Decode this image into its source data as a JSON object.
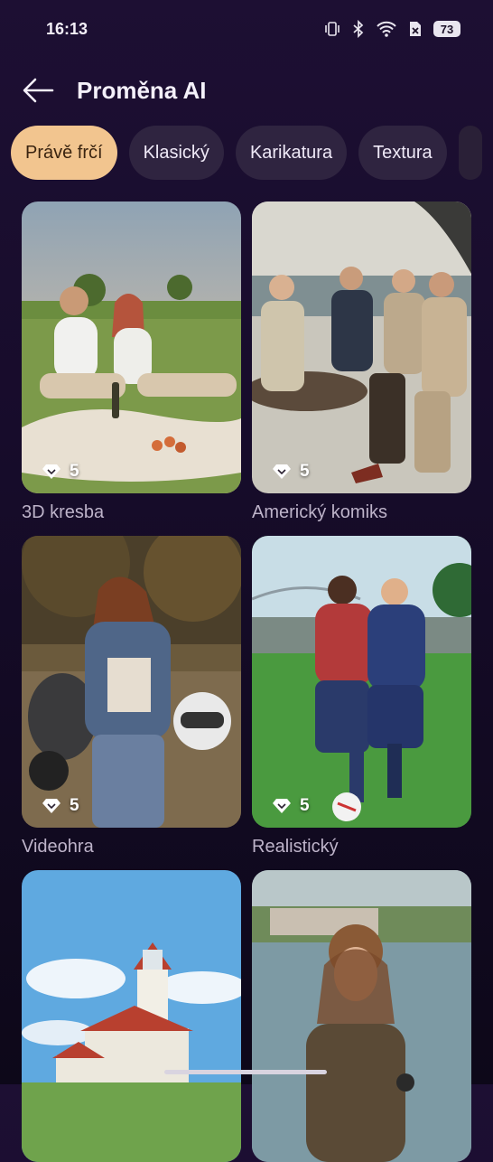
{
  "status": {
    "time": "16:13",
    "battery": "73"
  },
  "header": {
    "title": "Proměna AI"
  },
  "tabs": [
    {
      "label": "Právě frčí",
      "active": true
    },
    {
      "label": "Klasický"
    },
    {
      "label": "Karikatura"
    },
    {
      "label": "Textura"
    }
  ],
  "cards": [
    {
      "label": "3D kresba",
      "cost": "5"
    },
    {
      "label": "Americký komiks",
      "cost": "5"
    },
    {
      "label": "Videohra",
      "cost": "5"
    },
    {
      "label": "Realistický",
      "cost": "5"
    },
    {
      "label": "",
      "cost": ""
    },
    {
      "label": "",
      "cost": ""
    }
  ]
}
